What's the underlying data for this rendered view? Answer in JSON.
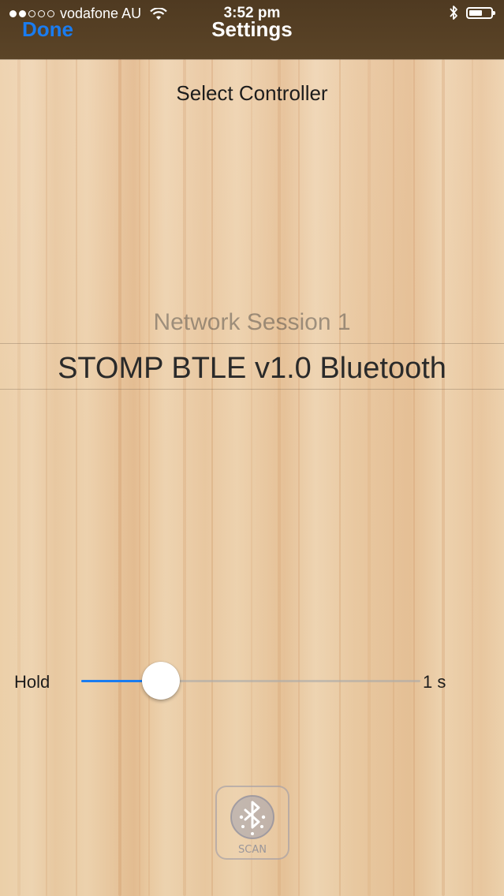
{
  "status_bar": {
    "carrier": "vodafone AU",
    "time": "3:52 pm",
    "signal_bars_filled": 2,
    "signal_bars_total": 5,
    "battery_level": 0.52
  },
  "nav": {
    "done_label": "Done",
    "title": "Settings"
  },
  "controller": {
    "heading": "Select Controller",
    "options": [
      "Network Session 1",
      "STOMP BTLE v1.0 Bluetooth"
    ],
    "selected": "STOMP BTLE v1.0 Bluetooth"
  },
  "hold": {
    "label": "Hold",
    "value_text": "1 s",
    "fraction": 0.235
  },
  "scan": {
    "label": "SCAN",
    "icon": "bluetooth-icon"
  },
  "colors": {
    "accent": "#1a7cf0",
    "nav_background": "#54402a",
    "wood": "#edd2ae"
  }
}
